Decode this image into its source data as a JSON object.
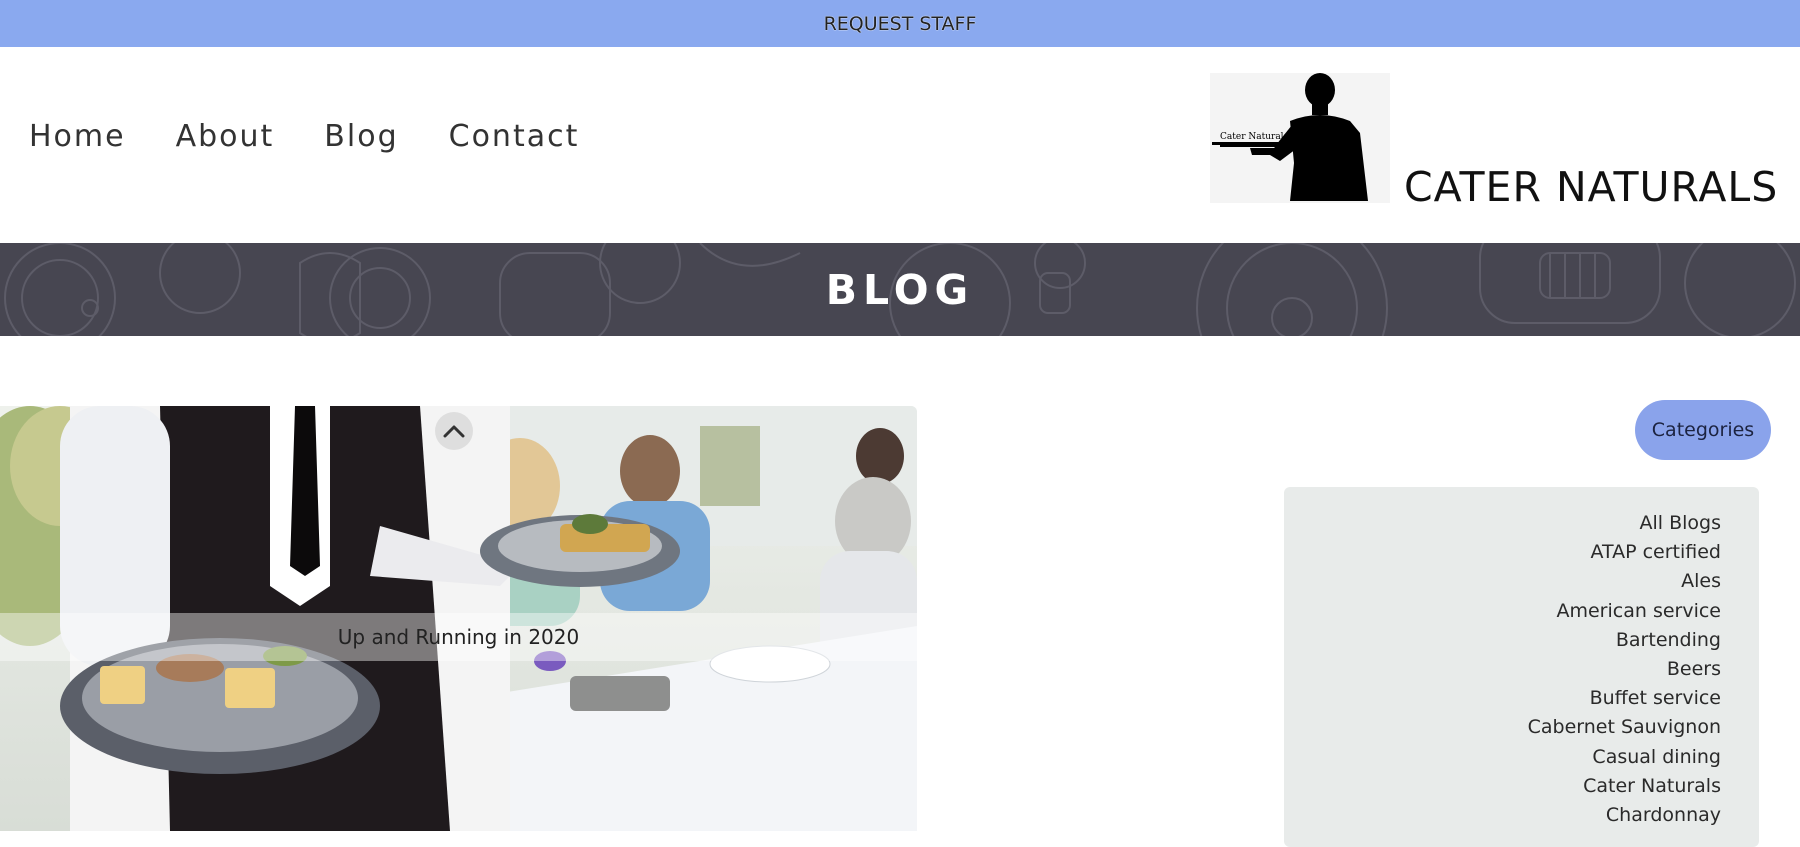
{
  "topbar": {
    "label": "REQUEST STAFF",
    "background": "#8aa9ef"
  },
  "nav": {
    "items": [
      {
        "label": "Home"
      },
      {
        "label": "About"
      },
      {
        "label": "Blog"
      },
      {
        "label": "Contact"
      }
    ]
  },
  "logo": {
    "tray_text": "Cater Naturals",
    "brand": "CATER NATURALS"
  },
  "banner": {
    "title": "BLOG",
    "background": "#474651"
  },
  "post": {
    "title": "Up and Running in 2020"
  },
  "categories": {
    "button_label": "Categories",
    "button_color": "#8aa3eb",
    "items": [
      "All Blogs",
      "ATAP certified",
      "Ales",
      "American service",
      "Bartending",
      "Beers",
      "Buffet service",
      "Cabernet Sauvignon",
      "Casual dining",
      "Cater Naturals",
      "Chardonnay"
    ]
  }
}
